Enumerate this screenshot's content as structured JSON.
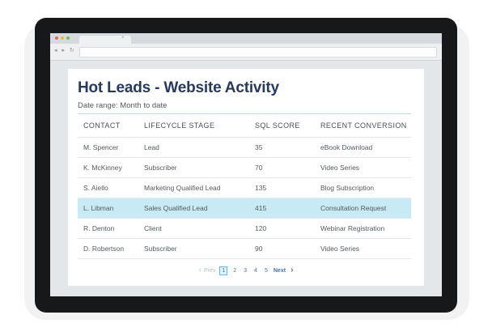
{
  "browser": {
    "dot_colors": [
      "#e2675f",
      "#e8b94a",
      "#6cc05a"
    ],
    "nav_icons": "◂ ▸ ↻ ⌂",
    "tab_close": "×"
  },
  "page": {
    "title": "Hot Leads - Website Activity",
    "subtitle": "Date range: Month to date"
  },
  "table": {
    "columns": [
      "CONTACT",
      "LIFECYCLE STAGE",
      "SQL SCORE",
      "RECENT CONVERSION"
    ],
    "rows": [
      [
        "M. Spencer",
        "Lead",
        "35",
        "eBook Download"
      ],
      [
        "K. McKinney",
        "Subscriber",
        "70",
        "Video Series"
      ],
      [
        "S. Aiello",
        "Marketing Qualified Lead",
        "135",
        "Blog Subscription"
      ],
      [
        "L. Libman",
        "Sales Qualified Lead",
        "415",
        "Consultation Request"
      ],
      [
        "R. Denton",
        "Client",
        "120",
        "Webinar Registration"
      ],
      [
        "D. Robertson",
        "Subscriber",
        "90",
        "Video Series"
      ]
    ],
    "highlighted_row": 3,
    "highlight_color": "#c8eaf4"
  },
  "pagination": {
    "prev_label": "Prev",
    "pages": [
      "1",
      "2",
      "3",
      "4",
      "5"
    ],
    "current_page": "1",
    "next_label": "Next"
  },
  "colors": {
    "title": "#283a5b",
    "link": "#3a78c8",
    "device": "#17181a"
  }
}
